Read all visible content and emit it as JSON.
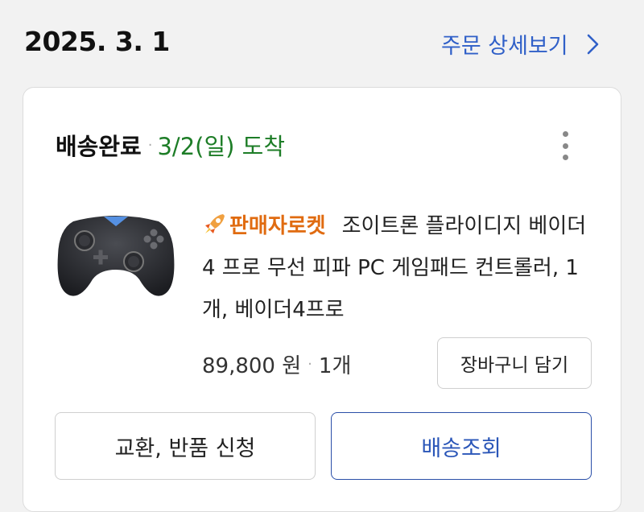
{
  "header": {
    "order_date": "2025. 3. 1",
    "detail_link": "주문 상세보기"
  },
  "order": {
    "status": "배송완료",
    "arrival": "3/2(일) 도착",
    "badge": "판매자로켓",
    "product_name": "조이트론 플라이디지 베이더4 프로 무선 피파 PC 게임패드 컨트롤러, 1개, 베이더4프로",
    "price": "89,800 원",
    "quantity": "1개",
    "cart_button": "장바구니 담기"
  },
  "actions": {
    "exchange_return": "교환, 반품 신청",
    "track_delivery": "배송조회"
  },
  "colors": {
    "link": "#3060c8",
    "arrival": "#1d7d27",
    "badge": "#e06b10",
    "track_border": "#2a4fa8"
  }
}
